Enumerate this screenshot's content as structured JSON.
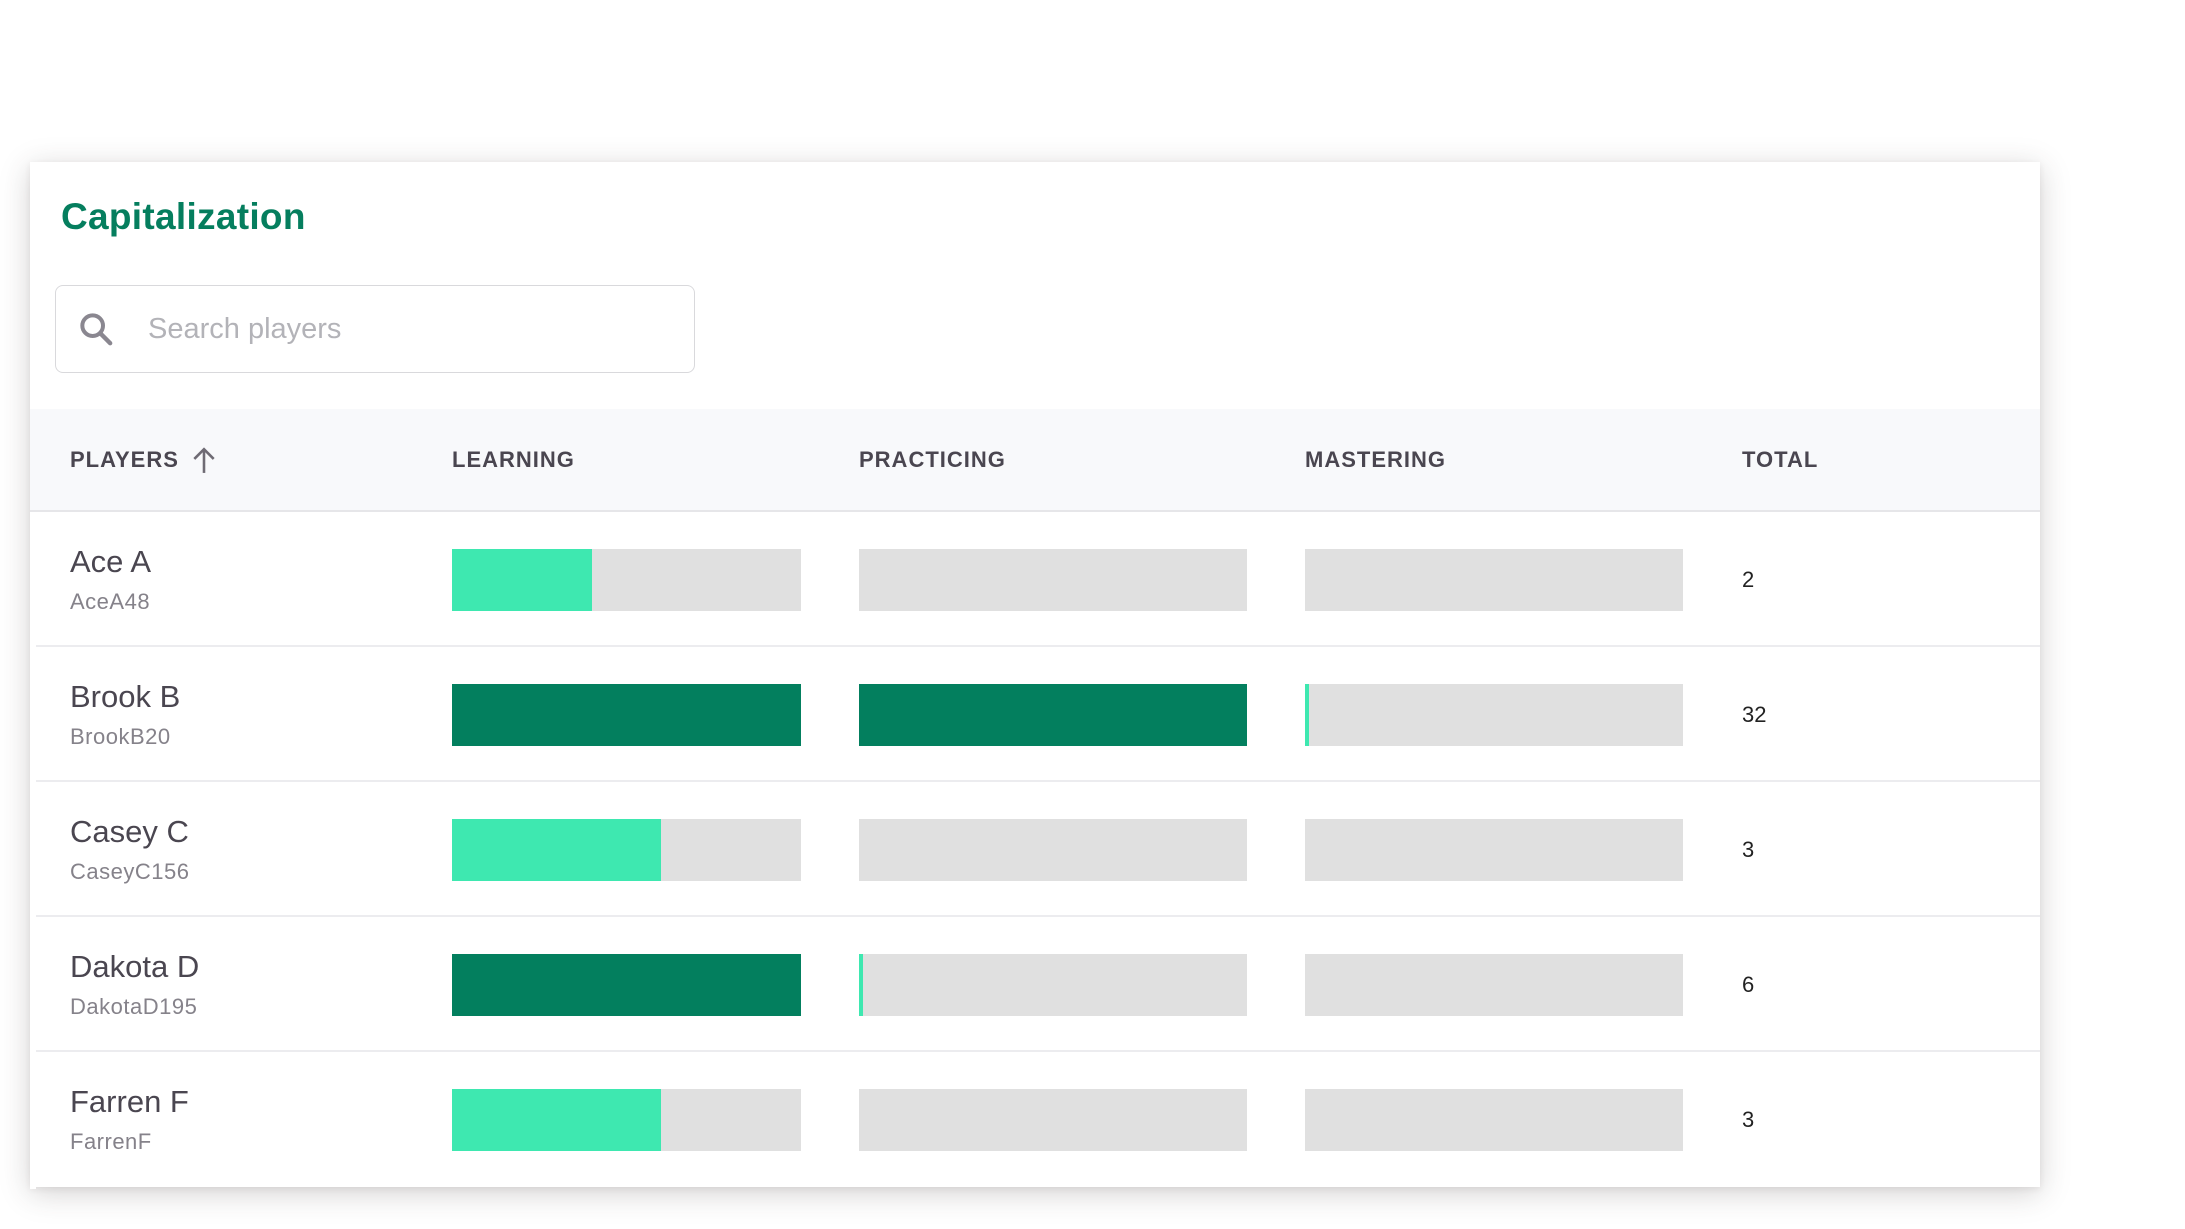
{
  "card": {
    "title": "Capitalization"
  },
  "search": {
    "icon": "search-icon",
    "placeholder": "Search players",
    "value": ""
  },
  "table": {
    "columns": {
      "players": "PLAYERS",
      "learning": "LEARNING",
      "practicing": "PRACTICING",
      "mastering": "MASTERING",
      "total": "TOTAL"
    },
    "sort": {
      "column": "players",
      "direction": "ascending",
      "icon": "arrow-up-icon"
    },
    "rows": [
      {
        "name": "Ace A",
        "username": "AceA48",
        "total": "2",
        "learning": {
          "progress": 0.4,
          "status": "in-progress"
        },
        "practicing": {
          "progress": 0.0,
          "status": "none"
        },
        "mastering": {
          "progress": 0.0,
          "status": "none"
        }
      },
      {
        "name": "Brook B",
        "username": "BrookB20",
        "total": "32",
        "learning": {
          "progress": 1.0,
          "status": "complete"
        },
        "practicing": {
          "progress": 1.0,
          "status": "complete"
        },
        "mastering": {
          "progress": 0.01,
          "status": "in-progress"
        }
      },
      {
        "name": "Casey C",
        "username": "CaseyC156",
        "total": "3",
        "learning": {
          "progress": 0.6,
          "status": "in-progress"
        },
        "practicing": {
          "progress": 0.0,
          "status": "none"
        },
        "mastering": {
          "progress": 0.0,
          "status": "none"
        }
      },
      {
        "name": "Dakota D",
        "username": "DakotaD195",
        "total": "6",
        "learning": {
          "progress": 1.0,
          "status": "complete"
        },
        "practicing": {
          "progress": 0.01,
          "status": "in-progress"
        },
        "mastering": {
          "progress": 0.0,
          "status": "none"
        }
      },
      {
        "name": "Farren F",
        "username": "FarrenF",
        "total": "3",
        "learning": {
          "progress": 0.6,
          "status": "in-progress"
        },
        "practicing": {
          "progress": 0.0,
          "status": "none"
        },
        "mastering": {
          "progress": 0.0,
          "status": "none"
        }
      }
    ]
  },
  "colors": {
    "title": "#057e5e",
    "in_progress": "#3ee8b0",
    "complete": "#037f5e",
    "track": "#e0e0e0",
    "header_bg": "#f8f9fb"
  }
}
